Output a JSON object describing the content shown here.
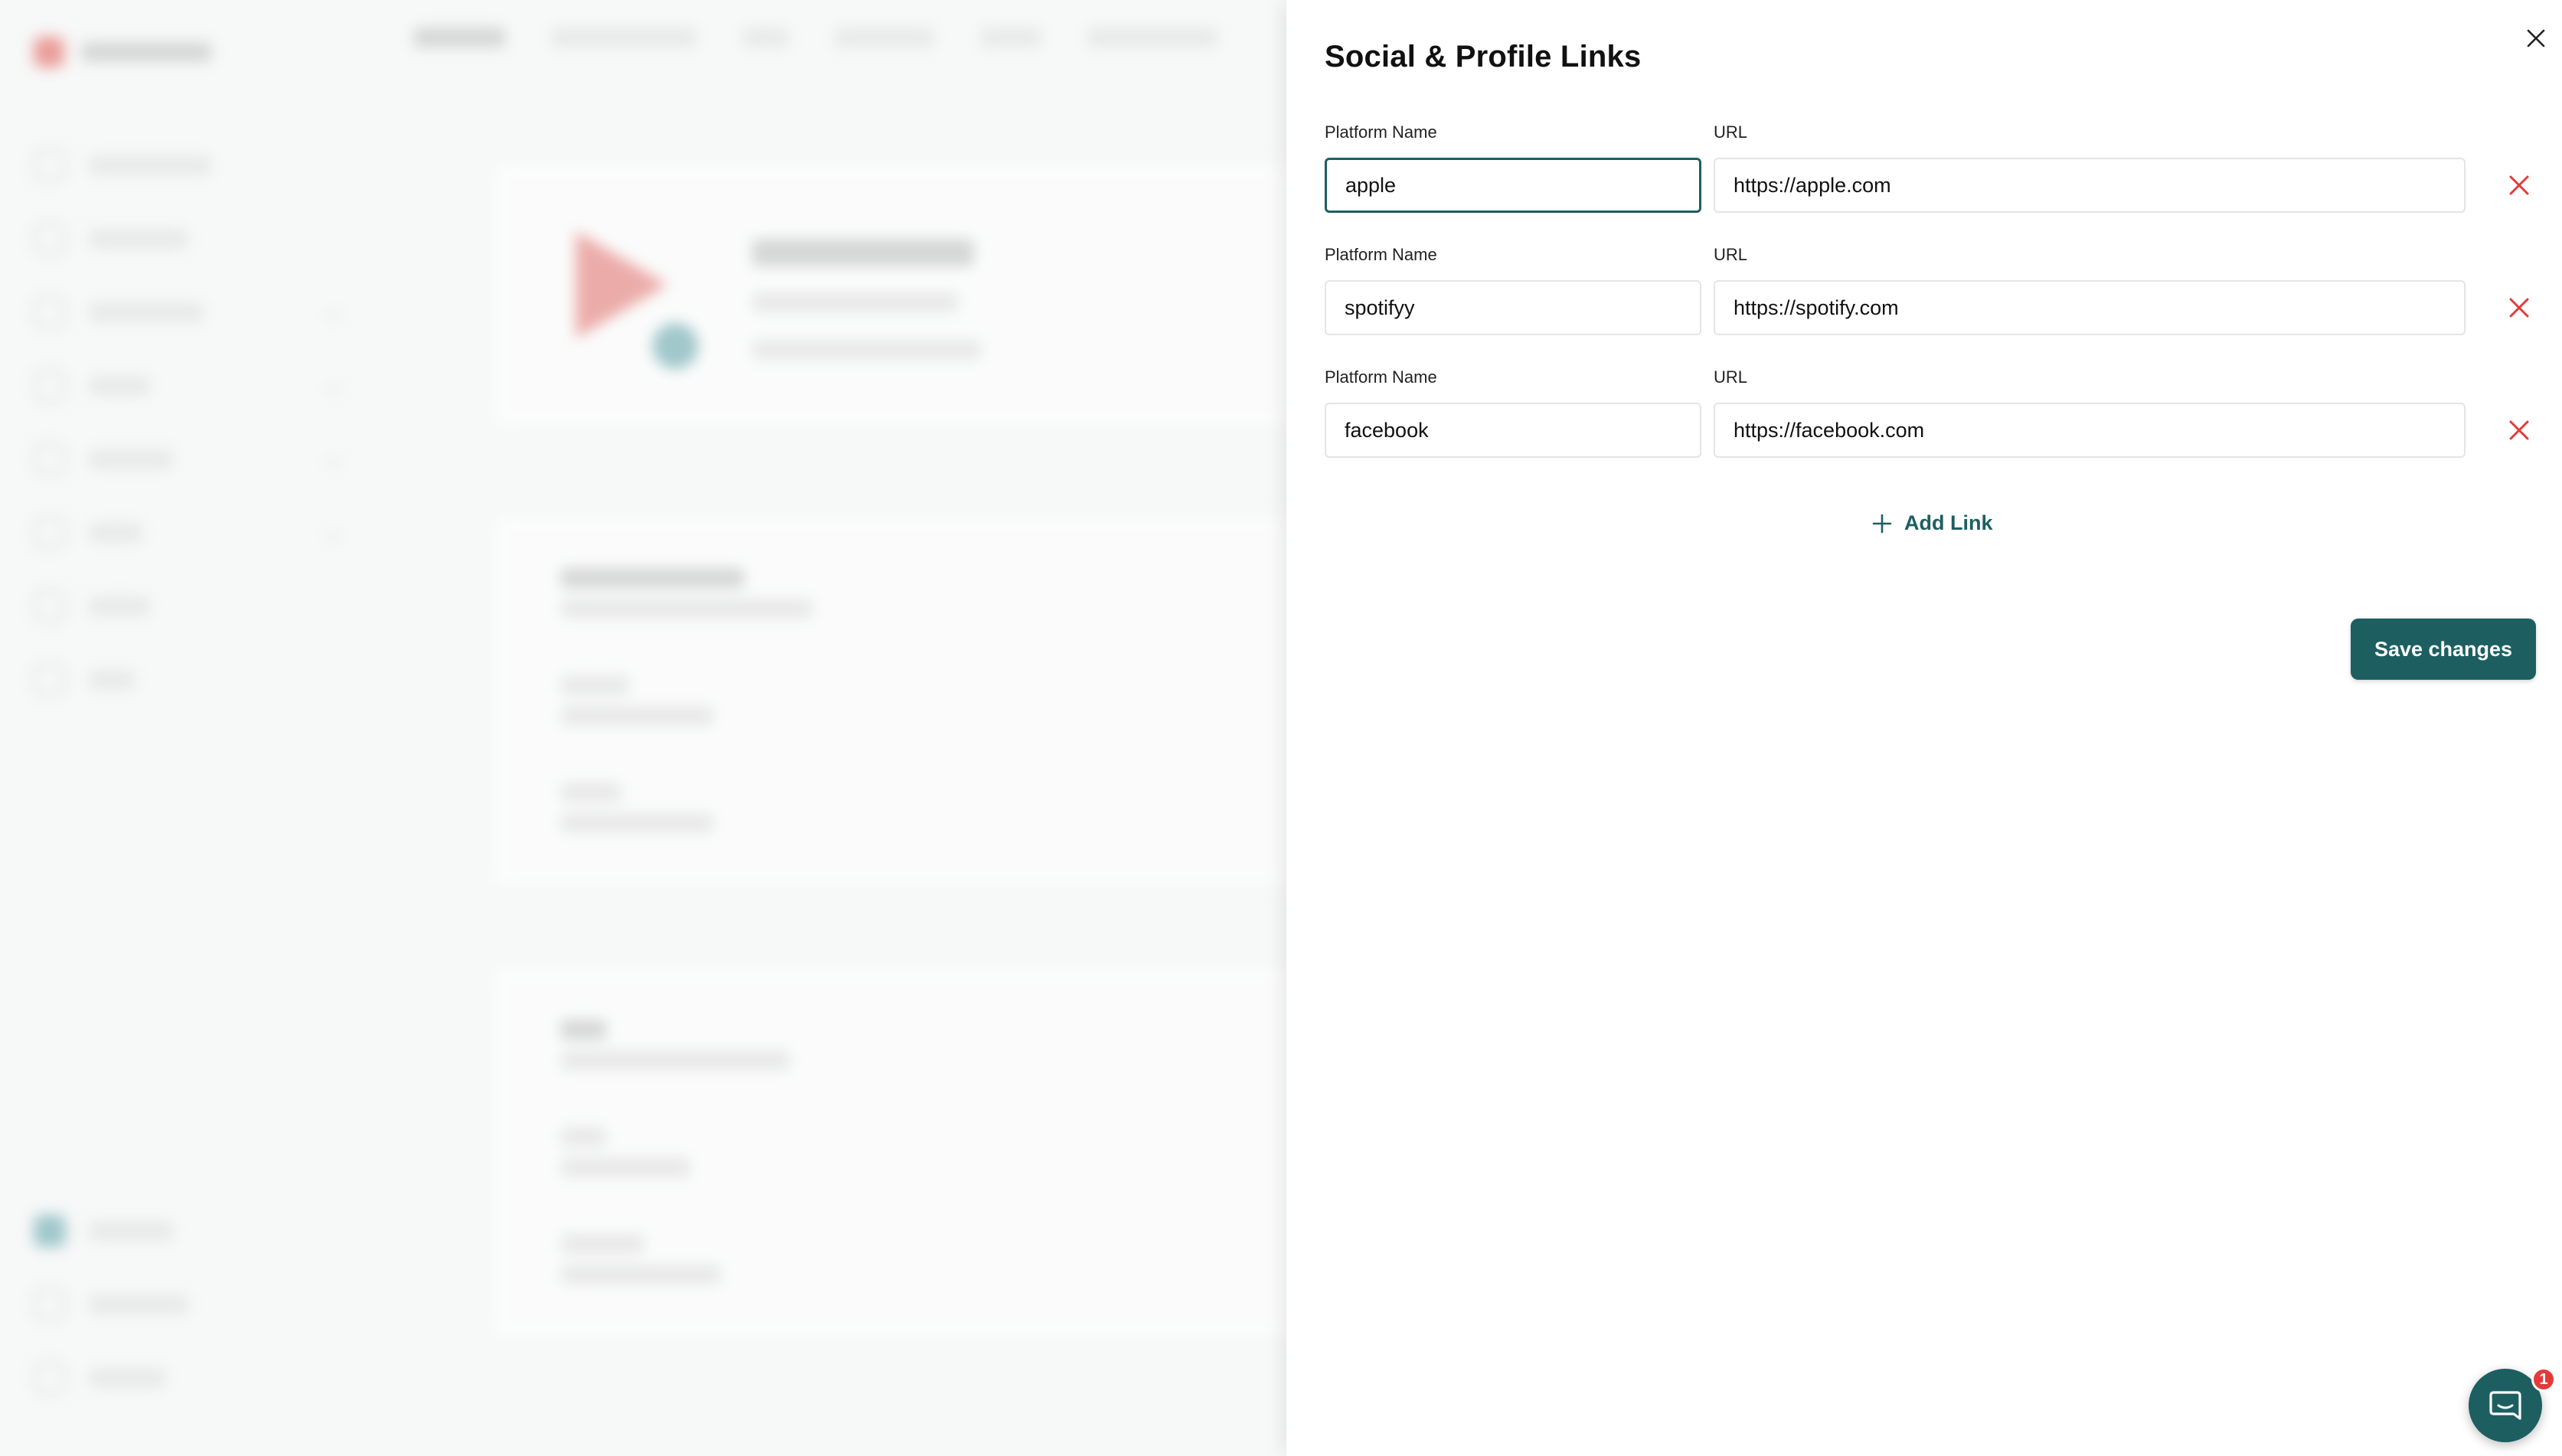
{
  "drawer": {
    "title": "Social & Profile Links",
    "close_icon": "close-icon"
  },
  "links": [
    {
      "name_label": "Platform Name",
      "url_label": "URL",
      "name": "apple",
      "url": "https://apple.com"
    },
    {
      "name_label": "Platform Name",
      "url_label": "URL",
      "name": "spotifyy",
      "url": "https://spotify.com"
    },
    {
      "name_label": "Platform Name",
      "url_label": "URL",
      "name": "facebook",
      "url": "https://facebook.com"
    }
  ],
  "actions": {
    "add_link_label": "Add Link",
    "save_label": "Save changes"
  },
  "chat": {
    "badge_count": "1"
  },
  "colors": {
    "accent": "#1d5f61",
    "danger": "#e23b3b",
    "border": "#e3e5e6"
  }
}
